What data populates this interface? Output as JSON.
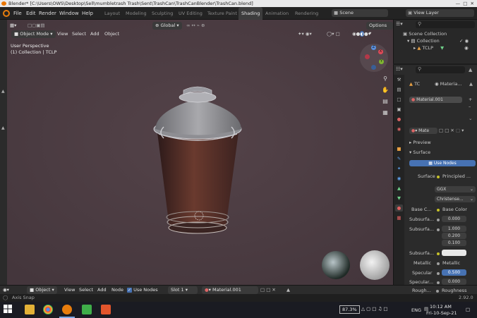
{
  "window_title": "Blender* [C:\\Users\\OWS\\Desktop\\Sell\\mumbletrash Trash\\Sent\\TrashCan\\TrashCanBlender\\TrashCan.blend]",
  "menu": [
    "File",
    "Edit",
    "Render",
    "Window",
    "Help"
  ],
  "workspaces": [
    "Layout",
    "Modeling",
    "Sculpting",
    "UV Editing",
    "Texture Paint",
    "Shading",
    "Animation",
    "Rendering"
  ],
  "active_workspace": "Shading",
  "scene": "Scene",
  "view_layer": "View Layer",
  "viewport": {
    "mode": "Object Mode",
    "menu": [
      "View",
      "Select",
      "Add",
      "Object"
    ],
    "orientation": "Global",
    "options": "Options",
    "perspective_label": "User Perspective",
    "collection_label": "(1) Collection | TCLP",
    "gizmo": {
      "x": "X",
      "y": "Y",
      "z": "Z"
    }
  },
  "outliner": {
    "root": "Scene Collection",
    "collection": "Collection",
    "object": "TCLP"
  },
  "properties": {
    "object_name": "TC",
    "material_tab": "Materia...",
    "material_slot": "Material.001",
    "material_field": "Mate",
    "panel_preview": "Preview",
    "panel_surface": "Surface",
    "use_nodes_button": "Use Nodes",
    "surface_label": "Surface",
    "surface_value": "Principled ...",
    "distribution": "GGX",
    "subsurface_method": "Christense...",
    "rows": [
      {
        "label": "Base C...",
        "value": "Base Color"
      },
      {
        "label": "Subsurfa...",
        "value": "0.000"
      },
      {
        "label": "Subsurfa...",
        "value": "1.000"
      },
      {
        "label": "",
        "value": "0.200"
      },
      {
        "label": "",
        "value": "0.100"
      },
      {
        "label": "Subsurfa...",
        "value": ""
      },
      {
        "label": "Metallic",
        "value": "Metallic"
      },
      {
        "label": "Specular",
        "value": "0.500"
      },
      {
        "label": "Specular...",
        "value": "0.000"
      },
      {
        "label": "Rough...",
        "value": "Roughness"
      }
    ]
  },
  "shader_bar": {
    "mode": "Object",
    "menu": [
      "View",
      "Select",
      "Add",
      "Node"
    ],
    "use_nodes": "Use Nodes",
    "slot": "Slot 1",
    "material": "Material.001"
  },
  "status": {
    "left": "Axis Snap",
    "version": "2.92.0"
  },
  "taskbar": {
    "zoom": "87.3%",
    "language": "ENG",
    "time": "10:12 AM",
    "date": "Fri-10-Sep-21"
  },
  "colors": {
    "accent_blue": "#4772b3",
    "blender_orange": "#e87d0d",
    "viewport_bg": "#4a3c42"
  }
}
